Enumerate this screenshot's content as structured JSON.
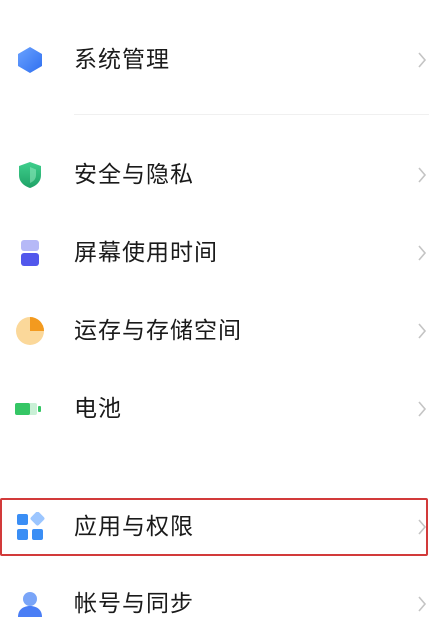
{
  "settings": {
    "items": [
      {
        "key": "system",
        "label": "系统管理",
        "icon": "system-hexagon-icon",
        "color": "#3f7df6"
      },
      {
        "key": "security",
        "label": "安全与隐私",
        "icon": "shield-icon",
        "color": "#27b07a"
      },
      {
        "key": "screen_time",
        "label": "屏幕使用时间",
        "icon": "hourglass-icon",
        "color": "#5b5ff0"
      },
      {
        "key": "storage",
        "label": "运存与存储空间",
        "icon": "pie-chart-icon",
        "color": "#f4a533"
      },
      {
        "key": "battery",
        "label": "电池",
        "icon": "battery-icon",
        "color": "#3ecb6b"
      },
      {
        "key": "apps",
        "label": "应用与权限",
        "icon": "app-grid-icon",
        "color": "#3a8ef5"
      },
      {
        "key": "account",
        "label": "帐号与同步",
        "icon": "person-icon",
        "color": "#4a7ef5"
      }
    ]
  },
  "highlight_color": "#d23a3a"
}
